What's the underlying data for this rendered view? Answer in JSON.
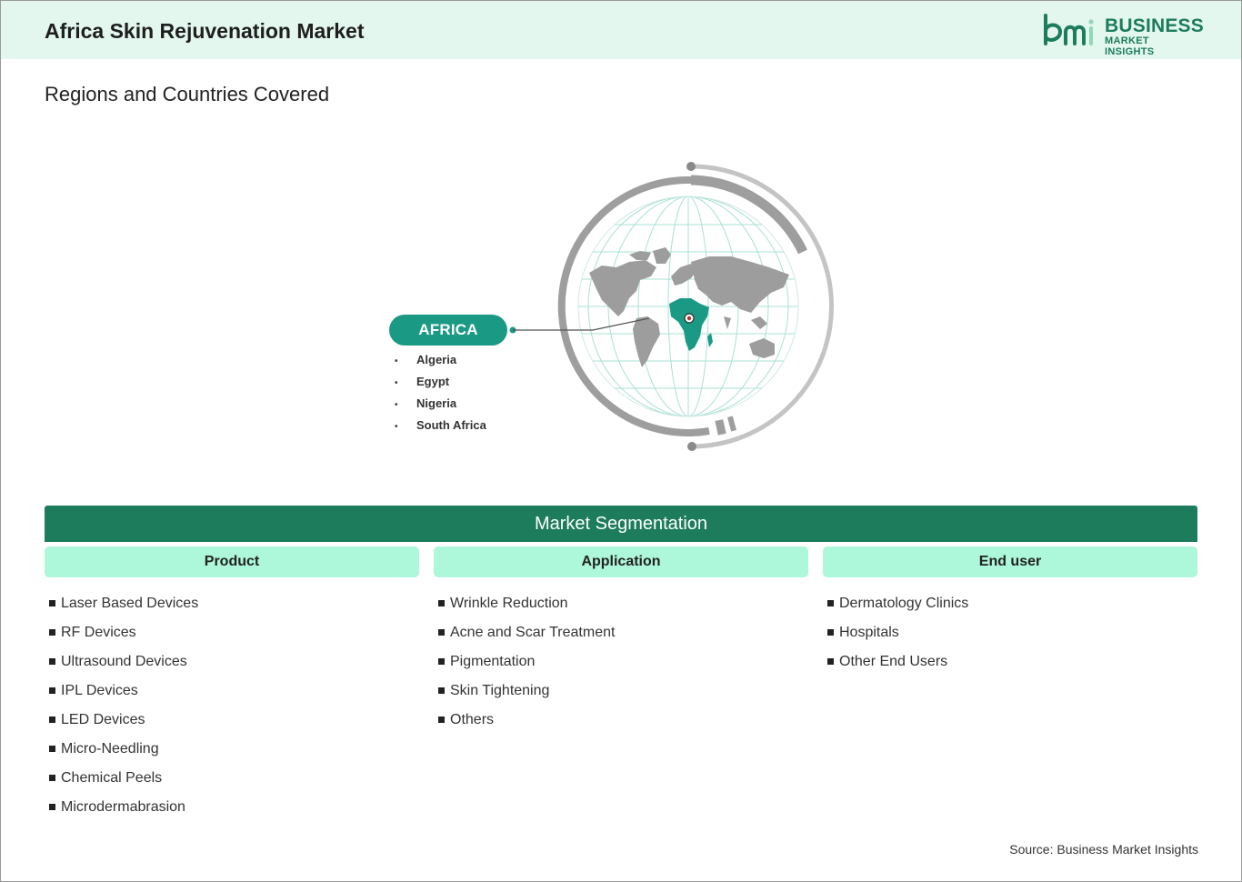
{
  "header": {
    "title": "Africa Skin Rejuvenation Market"
  },
  "logo": {
    "mark": "bmi",
    "line1": "BUSINESS",
    "line2": "MARKET INSIGHTS"
  },
  "regions": {
    "heading": "Regions and Countries Covered",
    "region": "AFRICA",
    "countries": [
      "Algeria",
      "Egypt",
      "Nigeria",
      "South Africa"
    ]
  },
  "segmentation": {
    "title": "Market Segmentation",
    "columns": [
      {
        "header": "Product",
        "items": [
          "Laser Based Devices",
          "RF Devices",
          "Ultrasound Devices",
          "IPL Devices",
          "LED Devices",
          "Micro-Needling",
          "Chemical Peels",
          "Microdermabrasion"
        ]
      },
      {
        "header": "Application",
        "items": [
          "Wrinkle Reduction",
          "Acne and Scar Treatment",
          "Pigmentation",
          "Skin Tightening",
          "Others"
        ]
      },
      {
        "header": "End user",
        "items": [
          "Dermatology Clinics",
          "Hospitals",
          "Other End Users"
        ]
      }
    ]
  },
  "source": "Source: Business Market Insights",
  "colors": {
    "brand": "#1c7c5c",
    "accent": "#1a9a84",
    "header_bg": "#e3f7ef",
    "column_head": "#adf7da"
  }
}
